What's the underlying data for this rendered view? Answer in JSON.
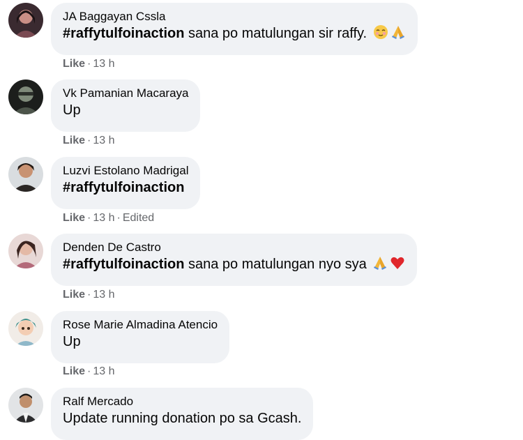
{
  "comments": [
    {
      "author": "JA Baggayan Cssla",
      "hashtag": "#raffytulfoinaction",
      "text": " sana po matulungan sir raffy.",
      "emojis": [
        "relieved-face",
        "folded-hands"
      ],
      "like_label": "Like",
      "time": "13 h",
      "edited": ""
    },
    {
      "author": "Vk Pamanian Macaraya",
      "hashtag": "",
      "text": "Up",
      "emojis": [],
      "like_label": "Like",
      "time": "13 h",
      "edited": ""
    },
    {
      "author": "Luzvi Estolano Madrigal",
      "hashtag": "#raffytulfoinaction",
      "text": "",
      "emojis": [],
      "like_label": "Like",
      "time": "13 h",
      "edited": "Edited"
    },
    {
      "author": "Denden De Castro",
      "hashtag": "#raffytulfoinaction",
      "text": " sana po matulungan nyo sya",
      "emojis": [
        "folded-hands",
        "red-heart"
      ],
      "like_label": "Like",
      "time": "13 h",
      "edited": ""
    },
    {
      "author": "Rose Marie Almadina Atencio",
      "hashtag": "",
      "text": "Up",
      "emojis": [],
      "like_label": "Like",
      "time": "13 h",
      "edited": ""
    },
    {
      "author": "Ralf Mercado",
      "hashtag": "",
      "text": "Update running donation po sa Gcash.",
      "emojis": [],
      "like_label": "",
      "time": "",
      "edited": ""
    }
  ],
  "separator": "·",
  "colors": {
    "bubble": "#f0f2f5",
    "text": "#050505",
    "meta": "#65676b"
  }
}
